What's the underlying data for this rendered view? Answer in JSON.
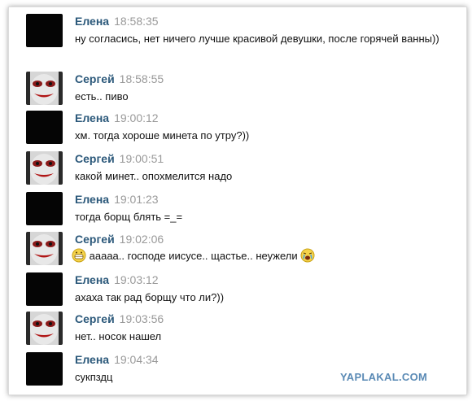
{
  "messages": [
    {
      "author": "Елена",
      "time": "18:58:35",
      "text": "ну согласись, нет ничего лучше красивой девушки, после горячей ванны))"
    },
    {
      "author": "Сергей",
      "time": "18:58:55",
      "text": "есть.. пиво"
    },
    {
      "author": "Елена",
      "time": "19:00:12",
      "text": "хм. тогда хороше минета по утру?))"
    },
    {
      "author": "Сергей",
      "time": "19:00:51",
      "text": "какой минет.. опохмелится надо"
    },
    {
      "author": "Елена",
      "time": "19:01:23",
      "text": "тогда борщ блять =_="
    },
    {
      "author": "Сергей",
      "time": "19:02:06",
      "text": "ааааа.. господе иисусе.. щастье.. неужели",
      "emoji_before": "grinning-emoji-icon",
      "emoji_after": "crying-emoji-icon"
    },
    {
      "author": "Елена",
      "time": "19:03:12",
      "text": "ахаха так рад борщу что ли?))"
    },
    {
      "author": "Сергей",
      "time": "19:03:56",
      "text": "нет.. носок нашел"
    },
    {
      "author": "Елена",
      "time": "19:04:34",
      "text": "сукпздц"
    }
  ],
  "watermark": "YAPLAKAL.COM",
  "colors": {
    "author": "#2b587a",
    "time": "#999999",
    "text": "#111111",
    "watermark": "#5a8ab5"
  },
  "icons": {
    "elena_avatar": "black-avatar",
    "sergey_avatar": "clown-face-avatar"
  }
}
